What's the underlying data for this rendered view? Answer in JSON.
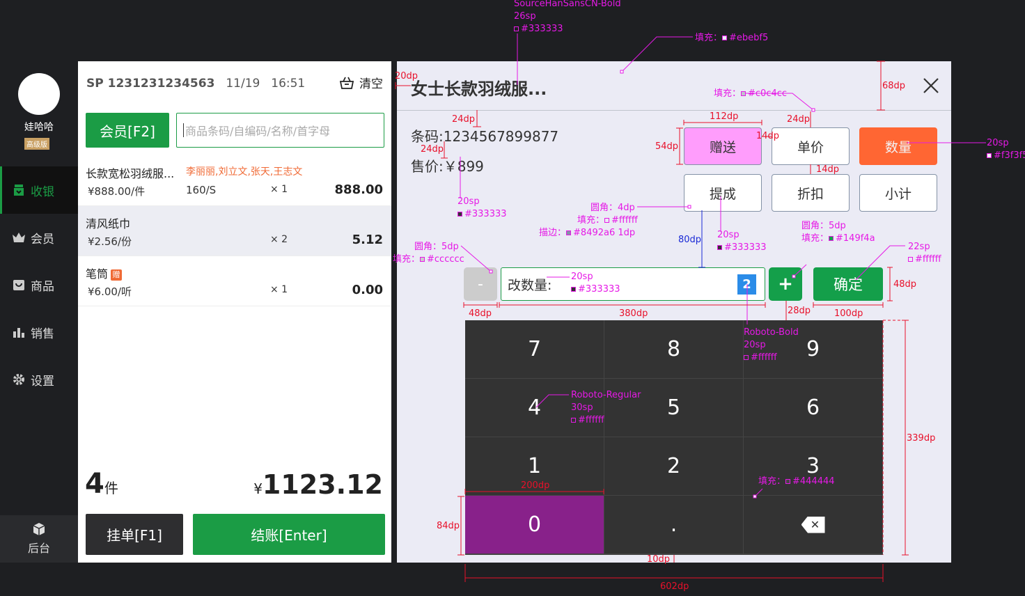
{
  "sidebar": {
    "username": "娃哈哈",
    "badge": "高级版",
    "items": [
      {
        "label": "收银",
        "icon": "cashier-icon"
      },
      {
        "label": "会员",
        "icon": "crown-icon"
      },
      {
        "label": "商品",
        "icon": "bag-icon"
      },
      {
        "label": "销售",
        "icon": "bar-chart-icon"
      },
      {
        "label": "设置",
        "icon": "gear-icon"
      }
    ],
    "backstage": "后台"
  },
  "order": {
    "order_no": "SP 1231231234563",
    "date": "11/19",
    "time": "16:51",
    "clear_label": "清空",
    "member_btn": "会员[F2]",
    "search_placeholder": "商品条码/自编码/名称/首字母",
    "rows": [
      {
        "name": "长款宽松羽绒服...",
        "staff": "李丽丽,刘立文,张天,王志文",
        "price": "¥888.00/件",
        "spec": "160/S",
        "qty": "× 1",
        "subtotal": "888.00"
      },
      {
        "name": "清风纸巾",
        "staff": "",
        "price": "¥2.56/份",
        "spec": "",
        "qty": "× 2",
        "subtotal": "5.12"
      },
      {
        "name": "笔筒",
        "staff": "",
        "price": "¥6.00/听",
        "spec": "",
        "qty": "× 1",
        "subtotal": "0.00",
        "gift": "赠"
      }
    ],
    "total_count": "4",
    "count_unit": "件",
    "currency": "¥",
    "total_amount": "1123.12",
    "hold_btn": "挂单[F1]",
    "checkout_btn": "结账[Enter]"
  },
  "dialog": {
    "title": "女士长款羽绒服...",
    "barcode": "条码:1234567899877",
    "price": "售价:￥899",
    "options": [
      "赠送",
      "单价",
      "数量",
      "提成",
      "折扣",
      "小计"
    ],
    "minus": "-",
    "plus": "+",
    "qty_label": "改数量:",
    "qty_value": "2",
    "confirm": "确定",
    "keys": [
      "7",
      "8",
      "9",
      "4",
      "5",
      "6",
      "1",
      "2",
      "3",
      "0",
      ".",
      "✕"
    ]
  },
  "annotations": {
    "font_title": "SourceHanSansCN-Bold",
    "font_title_size": "26sp",
    "font_title_color": "#333333",
    "fill_ebebf5": "填充：",
    "fill_ebebf5_val": "#ebebf5",
    "d20": "20dp",
    "d68": "68dp",
    "fill_c0c4cc": "填充：",
    "fill_c0c4cc_val": "#c0c4cc",
    "d24a": "24dp",
    "d112": "112dp",
    "d24b": "24dp",
    "d14a": "14dp",
    "d54": "54dp",
    "d24c": "24dp",
    "d14b": "14dp",
    "s20_right": "20sp",
    "s20_right_c": "#f3f3f5",
    "s20_a": "20sp",
    "s20_a_c": "#333333",
    "radius4": "圆角：4dp",
    "fill_fff": "填充：",
    "fill_fff_val": "#ffffff",
    "stroke": "描边：",
    "stroke_val": "#8492a6  1dp",
    "s20_b": "20sp",
    "s20_b_c": "#333333",
    "radius5_a": "圆角：5dp",
    "fill_ccc": "填充：",
    "fill_ccc_val": "#cccccc",
    "d80": "80dp",
    "radius5_b": "圆角：5dp",
    "fill_149": "填充：",
    "fill_149_val": "#149f4a",
    "s22": "22sp",
    "s22_c": "#ffffff",
    "s20_c": "20sp",
    "s20_c_c": "#333333",
    "d48a": "48dp",
    "d48b": "48dp",
    "d380": "380dp",
    "d28": "28dp",
    "d100": "100dp",
    "roboto_bold": "Roboto-Bold",
    "roboto_bold_s": "20sp",
    "roboto_bold_c": "#ffffff",
    "roboto_reg": "Roboto-Regular",
    "roboto_reg_s": "30sp",
    "roboto_reg_c": "#ffffff",
    "d339": "339dp",
    "d200": "200dp",
    "fill_444": "填充：",
    "fill_444_val": "#444444",
    "d84": "84dp",
    "d10": "10dp",
    "d602": "602dp"
  }
}
